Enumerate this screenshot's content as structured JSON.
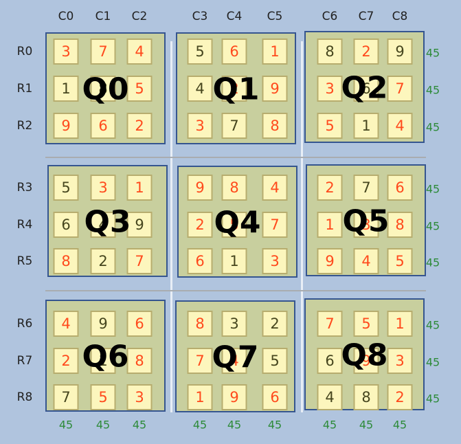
{
  "column_labels": [
    "C0",
    "C1",
    "C2",
    "C3",
    "C4",
    "C5",
    "C6",
    "C7",
    "C8"
  ],
  "row_labels": [
    "R0",
    "R1",
    "R2",
    "R3",
    "R4",
    "R5",
    "R6",
    "R7",
    "R8"
  ],
  "row_sums": [
    "45",
    "45",
    "45",
    "45",
    "45",
    "45",
    "45",
    "45",
    "45"
  ],
  "column_sums": [
    "45",
    "45",
    "45",
    "45",
    "45",
    "45",
    "45",
    "45",
    "45"
  ],
  "quadrant_labels": [
    "Q0",
    "Q1",
    "Q2",
    "Q3",
    "Q4",
    "Q5",
    "Q6",
    "Q7",
    "Q8"
  ],
  "colors": {
    "red_digit": "#ff4a1c",
    "dark_digit": "#46461e",
    "sum": "#2e8b3a",
    "box_border": "#35558f",
    "cell_bg": "#fcf6bd",
    "box_bg": "#c8cf9e",
    "background": "#b0c4de"
  },
  "grid": [
    [
      "3r",
      "7r",
      "4r",
      "5d",
      "6r",
      "1r",
      "8d",
      "2r",
      "9d"
    ],
    [
      "1d",
      "8d",
      "5r",
      "4d",
      "2r",
      "9r",
      "3r",
      "6d",
      "7r"
    ],
    [
      "9r",
      "6r",
      "2r",
      "3r",
      "7d",
      "8r",
      "5r",
      "1d",
      "4r"
    ],
    [
      "5d",
      "3r",
      "1r",
      "9r",
      "8r",
      "4r",
      "2r",
      "7d",
      "6r"
    ],
    [
      "6d",
      "4d",
      "9d",
      "2r",
      "5r",
      "7r",
      "1r",
      "3r",
      "8r"
    ],
    [
      "8r",
      "2d",
      "7r",
      "6r",
      "1d",
      "3r",
      "9r",
      "4r",
      "5r"
    ],
    [
      "4r",
      "9d",
      "6r",
      "8r",
      "3d",
      "2d",
      "7r",
      "5r",
      "1r"
    ],
    [
      "2r",
      "1d",
      "8r",
      "7r",
      "4r",
      "5d",
      "6d",
      "9r",
      "3r"
    ],
    [
      "7d",
      "5r",
      "3r",
      "1r",
      "9r",
      "6r",
      "4d",
      "8d",
      "2r"
    ]
  ]
}
